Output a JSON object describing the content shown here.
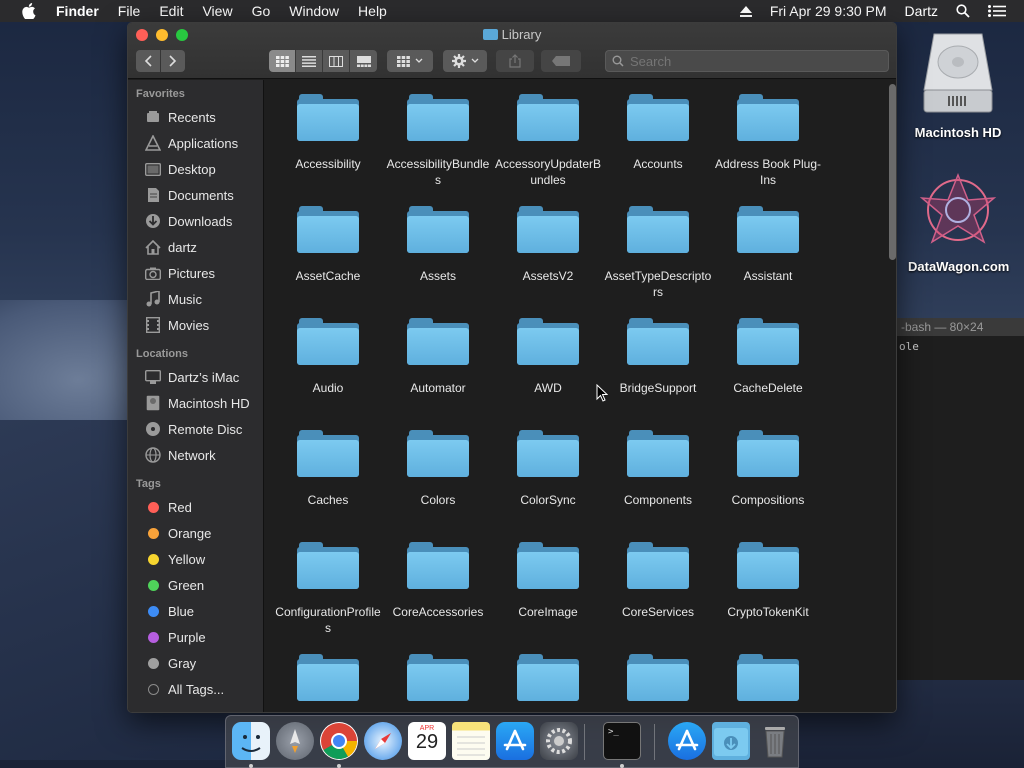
{
  "menubar": {
    "items": [
      "Finder",
      "File",
      "Edit",
      "View",
      "Go",
      "Window",
      "Help"
    ],
    "datetime": "Fri Apr 29  9:30 PM",
    "user": "Dartz"
  },
  "desktop": {
    "hd_label": "Macintosh HD",
    "datawagon_label": "DataWagon.com",
    "terminal_title": "-bash — 80×24",
    "terminal_line": "ole"
  },
  "finder": {
    "title": "Library",
    "search_placeholder": "Search",
    "sidebar": {
      "favorites_header": "Favorites",
      "favorites": [
        "Recents",
        "Applications",
        "Desktop",
        "Documents",
        "Downloads",
        "dartz",
        "Pictures",
        "Music",
        "Movies"
      ],
      "locations_header": "Locations",
      "locations": [
        "Dartz’s iMac",
        "Macintosh HD",
        "Remote Disc",
        "Network"
      ],
      "tags_header": "Tags",
      "tags": [
        {
          "label": "Red",
          "color": "#ff5f57"
        },
        {
          "label": "Orange",
          "color": "#f9a33a"
        },
        {
          "label": "Yellow",
          "color": "#f7d52f"
        },
        {
          "label": "Green",
          "color": "#4fd35a"
        },
        {
          "label": "Blue",
          "color": "#3d8cf5"
        },
        {
          "label": "Purple",
          "color": "#b65ee0"
        },
        {
          "label": "Gray",
          "color": "#a0a0a0"
        },
        {
          "label": "All Tags...",
          "color": ""
        }
      ]
    },
    "folders": [
      "Accessibility",
      "AccessibilityBundles",
      "AccessoryUpdaterBundles",
      "Accounts",
      "Address Book Plug-Ins",
      "AssetCache",
      "Assets",
      "AssetsV2",
      "AssetTypeDescriptors",
      "Assistant",
      "Audio",
      "Automator",
      "AWD",
      "BridgeSupport",
      "CacheDelete",
      "Caches",
      "Colors",
      "ColorSync",
      "Components",
      "Compositions",
      "ConfigurationProfiles",
      "CoreAccessories",
      "CoreImage",
      "CoreServices",
      "CryptoTokenKit",
      "",
      "",
      "",
      "",
      ""
    ]
  },
  "dock": {
    "apps": [
      "finder-icon",
      "launchpad-icon",
      "chrome-icon",
      "safari-icon",
      "calendar-icon",
      "notes-icon",
      "app-store-icon",
      "system-preferences-icon",
      "terminal-icon",
      "app-store-downloads-icon",
      "downloads-folder-icon",
      "trash-icon"
    ],
    "calendar_month": "APR",
    "calendar_day": "29"
  }
}
